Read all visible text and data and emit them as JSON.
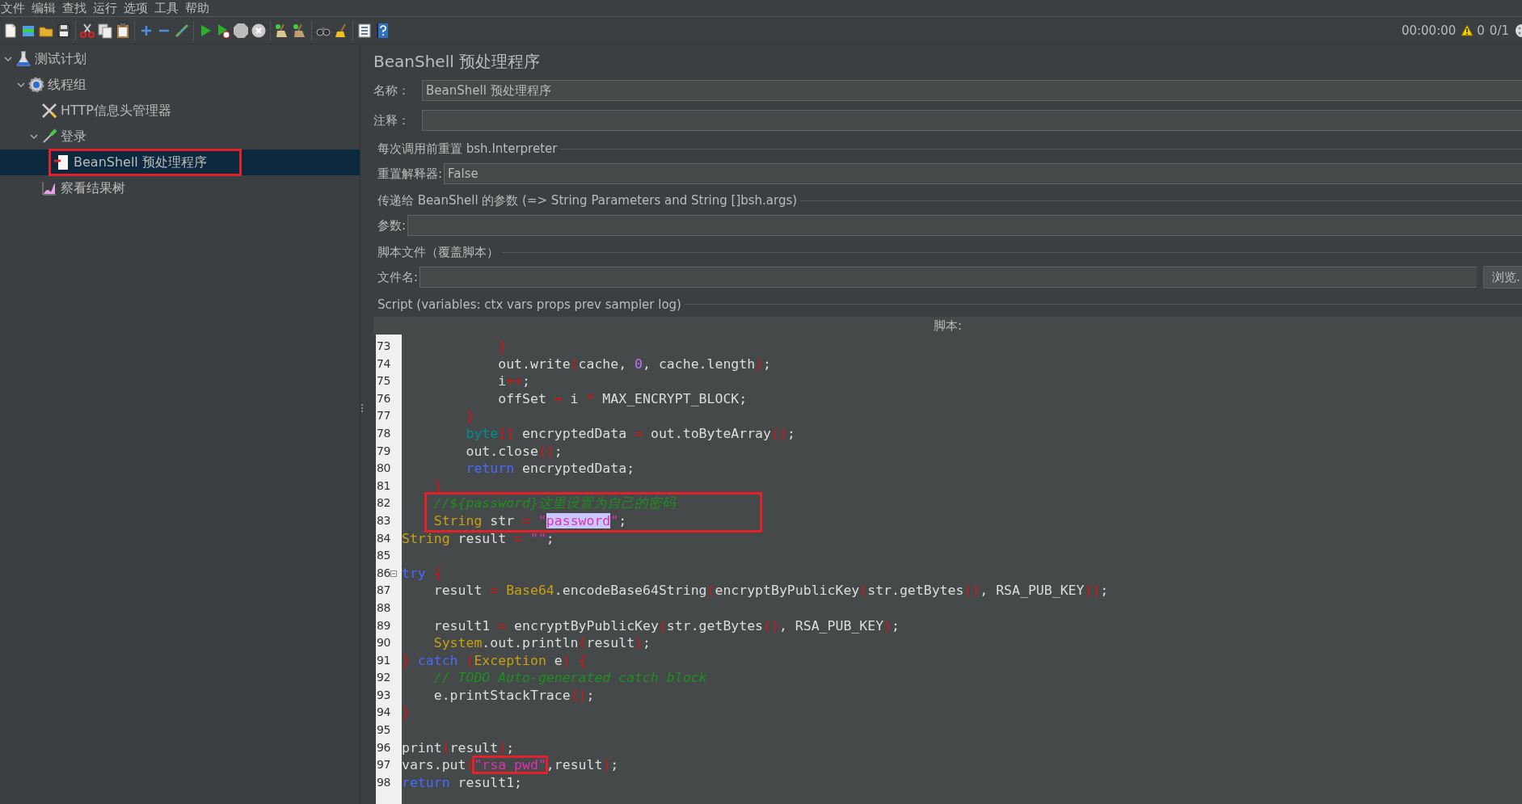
{
  "menu": [
    "文件",
    "编辑",
    "查找",
    "运行",
    "选项",
    "工具",
    "帮助"
  ],
  "status": {
    "elapsed": "00:00:00",
    "warnings": "0",
    "threads": "0/1"
  },
  "tree": [
    {
      "label": "测试计划",
      "kind": "plan",
      "expanded": true,
      "selected": false,
      "boxed": false,
      "children": [
        {
          "label": "线程组",
          "kind": "thread-group",
          "expanded": true,
          "selected": false,
          "boxed": false,
          "children": [
            {
              "label": "HTTP信息头管理器",
              "kind": "config",
              "selected": false,
              "boxed": false
            },
            {
              "label": "登录",
              "kind": "sampler",
              "expanded": true,
              "selected": false,
              "boxed": false,
              "children": [
                {
                  "label": "BeanShell 预处理程序",
                  "kind": "preprocessor",
                  "selected": true,
                  "boxed": true
                }
              ]
            },
            {
              "label": "察看结果树",
              "kind": "listener",
              "selected": false,
              "boxed": false
            }
          ]
        }
      ]
    }
  ],
  "panel": {
    "title": "BeanShell 预处理程序",
    "name_label": "名称：",
    "name_value": "BeanShell 预处理程序",
    "comment_label": "注释：",
    "reset_section": "每次调用前重置 bsh.Interpreter",
    "reset_label": "重置解释器:",
    "reset_value": "False",
    "params_section": "传递给 BeanShell 的参数 (=> String Parameters and String []bsh.args)",
    "params_label": "参数:",
    "file_section": "脚本文件（覆盖脚本）",
    "file_label": "文件名:",
    "browse_button": "浏览.",
    "script_section": "Script (variables: ctx vars props prev sampler log)",
    "script_label": "脚本:"
  },
  "code": [
    {
      "number": "73",
      "fold": false,
      "boxed": false,
      "tokens": [
        {
          "t": "            }",
          "kind": "op"
        }
      ]
    },
    {
      "number": "74",
      "fold": false,
      "boxed": false,
      "tokens": [
        {
          "t": "            out.write",
          "kind": "plain"
        },
        {
          "t": "(",
          "kind": "op"
        },
        {
          "t": "cache, ",
          "kind": "plain"
        },
        {
          "t": "0",
          "kind": "num"
        },
        {
          "t": ", cache.length",
          "kind": "plain"
        },
        {
          "t": ")",
          "kind": "op"
        },
        {
          "t": ";",
          "kind": "plain"
        }
      ]
    },
    {
      "number": "75",
      "fold": false,
      "boxed": false,
      "tokens": [
        {
          "t": "            i",
          "kind": "plain"
        },
        {
          "t": "++",
          "kind": "op"
        },
        {
          "t": ";",
          "kind": "plain"
        }
      ]
    },
    {
      "number": "76",
      "fold": false,
      "boxed": false,
      "tokens": [
        {
          "t": "            offSet ",
          "kind": "plain"
        },
        {
          "t": "=",
          "kind": "op"
        },
        {
          "t": " i ",
          "kind": "plain"
        },
        {
          "t": "*",
          "kind": "op"
        },
        {
          "t": " MAX_ENCRYPT_BLOCK;",
          "kind": "plain"
        }
      ]
    },
    {
      "number": "77",
      "fold": false,
      "boxed": false,
      "tokens": [
        {
          "t": "        }",
          "kind": "op"
        }
      ]
    },
    {
      "number": "78",
      "fold": false,
      "boxed": false,
      "tokens": [
        {
          "t": "        byte",
          "kind": "prim"
        },
        {
          "t": "[]",
          "kind": "op"
        },
        {
          "t": " encryptedData ",
          "kind": "plain"
        },
        {
          "t": "=",
          "kind": "op"
        },
        {
          "t": " out.toByteArray",
          "kind": "plain"
        },
        {
          "t": "()",
          "kind": "op"
        },
        {
          "t": ";",
          "kind": "plain"
        }
      ]
    },
    {
      "number": "79",
      "fold": false,
      "boxed": false,
      "tokens": [
        {
          "t": "        out.close",
          "kind": "plain"
        },
        {
          "t": "()",
          "kind": "op"
        },
        {
          "t": ";",
          "kind": "plain"
        }
      ]
    },
    {
      "number": "80",
      "fold": false,
      "boxed": false,
      "tokens": [
        {
          "t": "        return",
          "kind": "kw"
        },
        {
          "t": " encryptedData;",
          "kind": "plain"
        }
      ]
    },
    {
      "number": "81",
      "fold": false,
      "boxed": false,
      "tokens": [
        {
          "t": "    }",
          "kind": "op"
        }
      ]
    },
    {
      "number": "82",
      "fold": false,
      "boxed": true,
      "tokens": [
        {
          "t": "    //${password}这里设置为自己的密码",
          "kind": "cmt"
        }
      ]
    },
    {
      "number": "83",
      "fold": false,
      "boxed": true,
      "tokens": [
        {
          "t": "    String",
          "kind": "type"
        },
        {
          "t": " str ",
          "kind": "plain"
        },
        {
          "t": "=",
          "kind": "op"
        },
        {
          "t": " \"",
          "kind": "str"
        },
        {
          "t": "password",
          "kind": "sel"
        },
        {
          "t": "\"",
          "kind": "str"
        },
        {
          "t": ";",
          "kind": "plain"
        }
      ]
    },
    {
      "number": "84",
      "fold": false,
      "boxed": false,
      "tokens": [
        {
          "t": "String",
          "kind": "type"
        },
        {
          "t": " result ",
          "kind": "plain"
        },
        {
          "t": "=",
          "kind": "op"
        },
        {
          "t": " \"\"",
          "kind": "str"
        },
        {
          "t": ";",
          "kind": "plain"
        }
      ]
    },
    {
      "number": "85",
      "fold": false
    },
    {
      "number": "86",
      "fold": true,
      "boxed": false,
      "tokens": [
        {
          "t": "try",
          "kind": "kw"
        },
        {
          "t": " {",
          "kind": "op"
        }
      ]
    },
    {
      "number": "87",
      "fold": false,
      "boxed": false,
      "tokens": [
        {
          "t": "    result ",
          "kind": "plain"
        },
        {
          "t": "=",
          "kind": "op"
        },
        {
          "t": " Base64",
          "kind": "type"
        },
        {
          "t": ".encodeBase64String",
          "kind": "plain"
        },
        {
          "t": "(",
          "kind": "op"
        },
        {
          "t": "encryptByPublicKey",
          "kind": "plain"
        },
        {
          "t": "(",
          "kind": "op"
        },
        {
          "t": "str.getBytes",
          "kind": "plain"
        },
        {
          "t": "()",
          "kind": "op"
        },
        {
          "t": ", RSA_PUB_KEY",
          "kind": "plain"
        },
        {
          "t": "))",
          "kind": "op"
        },
        {
          "t": ";",
          "kind": "plain"
        }
      ]
    },
    {
      "number": "88",
      "fold": false
    },
    {
      "number": "89",
      "fold": false,
      "boxed": false,
      "tokens": [
        {
          "t": "    result1 ",
          "kind": "plain"
        },
        {
          "t": "=",
          "kind": "op"
        },
        {
          "t": " encryptByPublicKey",
          "kind": "plain"
        },
        {
          "t": "(",
          "kind": "op"
        },
        {
          "t": "str.getBytes",
          "kind": "plain"
        },
        {
          "t": "()",
          "kind": "op"
        },
        {
          "t": ", RSA_PUB_KEY",
          "kind": "plain"
        },
        {
          "t": ")",
          "kind": "op"
        },
        {
          "t": ";",
          "kind": "plain"
        }
      ]
    },
    {
      "number": "90",
      "fold": false,
      "boxed": false,
      "tokens": [
        {
          "t": "    System",
          "kind": "type"
        },
        {
          "t": ".out.println",
          "kind": "plain"
        },
        {
          "t": "(",
          "kind": "op"
        },
        {
          "t": "result",
          "kind": "plain"
        },
        {
          "t": ")",
          "kind": "op"
        },
        {
          "t": ";",
          "kind": "plain"
        }
      ]
    },
    {
      "number": "91",
      "fold": false,
      "boxed": false,
      "tokens": [
        {
          "t": "} ",
          "kind": "op"
        },
        {
          "t": "catch",
          "kind": "kw"
        },
        {
          "t": " (",
          "kind": "op"
        },
        {
          "t": "Exception",
          "kind": "type"
        },
        {
          "t": " e",
          "kind": "plain"
        },
        {
          "t": ") {",
          "kind": "op"
        }
      ]
    },
    {
      "number": "92",
      "fold": false,
      "boxed": false,
      "tokens": [
        {
          "t": "    // TODO Auto-generated catch block",
          "kind": "cmt"
        }
      ]
    },
    {
      "number": "93",
      "fold": false,
      "boxed": false,
      "tokens": [
        {
          "t": "    e.printStackTrace",
          "kind": "plain"
        },
        {
          "t": "()",
          "kind": "op"
        },
        {
          "t": ";",
          "kind": "plain"
        }
      ]
    },
    {
      "number": "94",
      "fold": false,
      "boxed": false,
      "tokens": [
        {
          "t": "}",
          "kind": "op"
        }
      ]
    },
    {
      "number": "95",
      "fold": false
    },
    {
      "number": "96",
      "fold": false,
      "boxed": false,
      "tokens": [
        {
          "t": "print",
          "kind": "plain"
        },
        {
          "t": "(",
          "kind": "op"
        },
        {
          "t": "result",
          "kind": "plain"
        },
        {
          "t": ")",
          "kind": "op"
        },
        {
          "t": ";",
          "kind": "plain"
        }
      ]
    },
    {
      "number": "97",
      "fold": false,
      "boxed": false,
      "tokens": [
        {
          "t": "vars.put",
          "kind": "plain"
        },
        {
          "t": "(",
          "kind": "op"
        },
        {
          "t": "\"rsa_pwd\"",
          "kind": "str",
          "boxed": true
        },
        {
          "t": ",result",
          "kind": "plain"
        },
        {
          "t": ")",
          "kind": "op"
        },
        {
          "t": ";",
          "kind": "plain"
        }
      ]
    },
    {
      "number": "98",
      "fold": false,
      "boxed": false,
      "tokens": [
        {
          "t": "return",
          "kind": "kw"
        },
        {
          "t": " result1;",
          "kind": "plain"
        }
      ]
    }
  ]
}
